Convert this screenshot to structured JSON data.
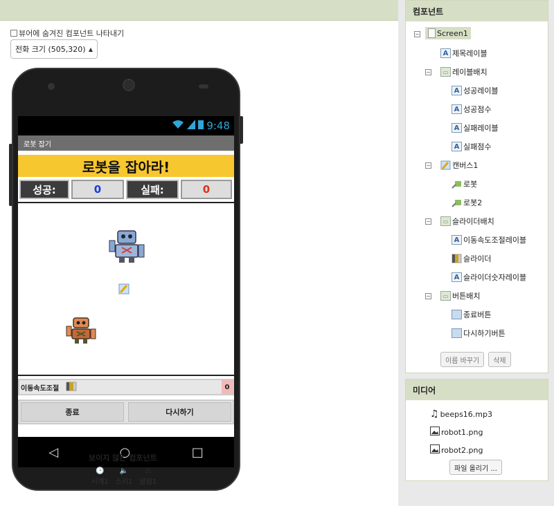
{
  "viewer": {
    "show_hidden_label": "뷰어에 숨겨진 컴포넌트 나타내기",
    "size_option": "전화 크기 (505,320)"
  },
  "phone": {
    "time": "9:48",
    "title": "로봇 잡기",
    "banner": "로봇을 잡아라!",
    "success_label": "성공:",
    "success_value": "0",
    "fail_label": "실패:",
    "fail_value": "0",
    "slider_label": "이동속도조절",
    "slider_value": "0",
    "exit_button": "종료",
    "restart_button": "다시하기"
  },
  "nonvisible": {
    "title": "보이지 않는 컴포넌트",
    "items": [
      "시계1",
      "소리1",
      "알림1"
    ]
  },
  "components": {
    "header": "컴포넌트",
    "tree": [
      "Screen1",
      "제목레이블",
      "레이블배치",
      "성공레이블",
      "성공점수",
      "실패레이블",
      "실패점수",
      "캔버스1",
      "로봇",
      "로봇2",
      "슬라이더배치",
      "이동속도조절레이블",
      "슬라이더",
      "슬라이더숫자레이블",
      "버튼배치",
      "종료버튼",
      "다시하기버튼"
    ],
    "rename_button": "이름 바꾸기",
    "delete_button": "삭제"
  },
  "media": {
    "header": "미디어",
    "files": [
      "beeps16.mp3",
      "robot1.png",
      "robot2.png"
    ],
    "upload_button": "파일 올리기 ..."
  },
  "colors": {
    "banner": "#f7c72f",
    "success_value": "#1a3dd9",
    "fail_value": "#d9341a",
    "panel_header": "#d6dfc5"
  }
}
